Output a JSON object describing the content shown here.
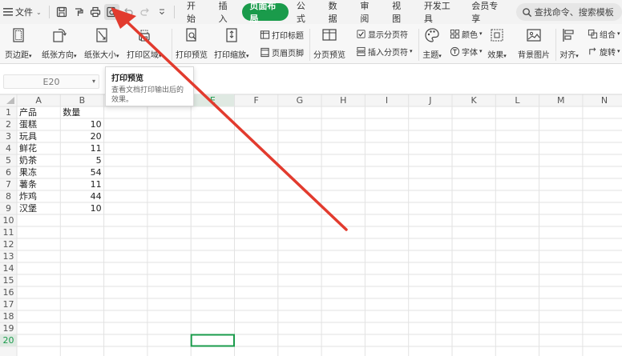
{
  "menubar": {
    "file_label": "文件",
    "tabs": [
      {
        "label": "开始",
        "active": false
      },
      {
        "label": "插入",
        "active": false
      },
      {
        "label": "页面布局",
        "active": true
      },
      {
        "label": "公式",
        "active": false
      },
      {
        "label": "数据",
        "active": false
      },
      {
        "label": "审阅",
        "active": false
      },
      {
        "label": "视图",
        "active": false
      },
      {
        "label": "开发工具",
        "active": false
      },
      {
        "label": "会员专享",
        "active": false
      }
    ],
    "search_placeholder": "查找命令、搜索模板"
  },
  "ribbon": {
    "margins": "页边距",
    "orientation": "纸张方向",
    "size": "纸张大小",
    "print_area": "打印区域",
    "print_preview": "打印预览",
    "print_scale": "打印缩放",
    "print_titles": "打印标题",
    "header_footer": "页眉页脚",
    "page_break_preview": "分页预览",
    "show_page_breaks": "显示分页符",
    "insert_page_break": "插入分页符",
    "theme": "主题",
    "colors": "颜色",
    "fonts": "字体",
    "effects": "效果",
    "background": "背景图片",
    "align": "对齐",
    "group": "组合",
    "rotate": "旋转"
  },
  "namebox": {
    "value": "E20"
  },
  "tooltip": {
    "title": "打印预览",
    "description": "查看文档打印输出后的效果。"
  },
  "grid": {
    "columns": [
      "A",
      "B",
      "C",
      "D",
      "E",
      "F",
      "G",
      "H",
      "I",
      "J",
      "K",
      "L",
      "M",
      "N"
    ],
    "rows": [
      "1",
      "2",
      "3",
      "4",
      "5",
      "6",
      "7",
      "8",
      "9",
      "10",
      "11",
      "12",
      "13",
      "14",
      "15",
      "16",
      "17",
      "18",
      "19",
      "20"
    ],
    "selected_cell": "E20",
    "selected_row": "20",
    "selected_col": "E"
  },
  "sheet": {
    "header": [
      "产品",
      "数量"
    ],
    "products": [
      {
        "name": "蛋糕",
        "qty": "10"
      },
      {
        "name": "玩具",
        "qty": "20"
      },
      {
        "name": "鲜花",
        "qty": "11"
      },
      {
        "name": "奶茶",
        "qty": "5"
      },
      {
        "name": "果冻",
        "qty": "54"
      },
      {
        "name": "薯条",
        "qty": "11"
      },
      {
        "name": "炸鸡",
        "qty": "44"
      },
      {
        "name": "汉堡",
        "qty": "10"
      }
    ]
  },
  "colors": {
    "accent_green": "#1a9b4b",
    "arrow_red": "#e23b2e",
    "grid_line": "#e2e2e2"
  }
}
